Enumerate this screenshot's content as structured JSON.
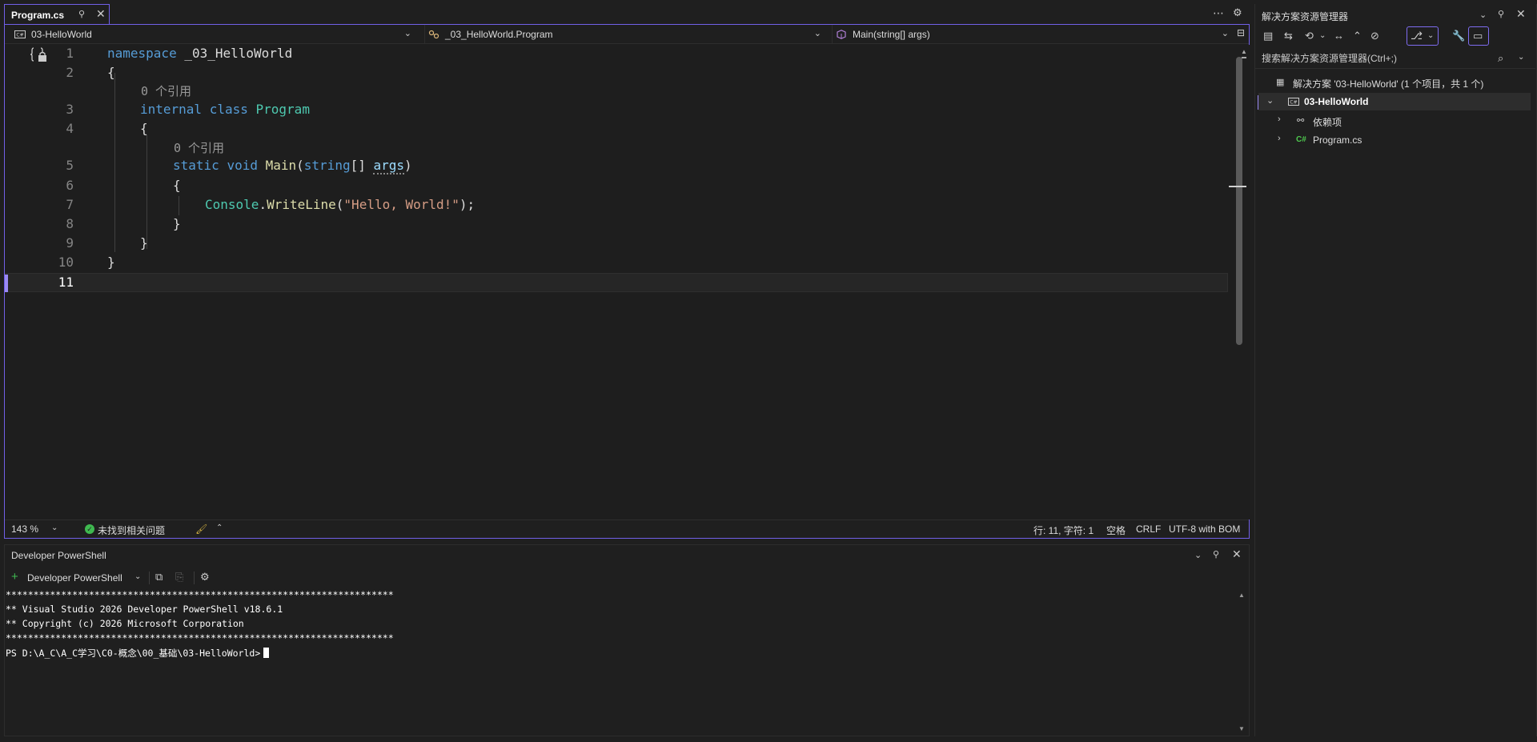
{
  "editor": {
    "tab": {
      "label": "Program.cs",
      "pin_icon": "pin-icon",
      "close_icon": "close-icon"
    },
    "nav": {
      "project": "03-HelloWorld",
      "class": "_03_HelloWorld.Program",
      "member": "Main(string[] args)"
    },
    "code": {
      "line_numbers": [
        "1",
        "2",
        "3",
        "4",
        "5",
        "6",
        "7",
        "8",
        "9",
        "10",
        "11"
      ],
      "codelens_refs": "0 个引用",
      "kw_namespace": "namespace",
      "ns_name": "_03_HelloWorld",
      "kw_internal": "internal",
      "kw_class": "class",
      "class_name": "Program",
      "kw_static": "static",
      "kw_void": "void",
      "method_name": "Main",
      "kw_string": "string",
      "param_name": "args",
      "console": "Console",
      "writeline": "WriteLine",
      "string_literal": "\"Hello, World!\"",
      "open_brace": "{",
      "close_brace": "}"
    },
    "status": {
      "zoom": "143 %",
      "issues": "未找到相关问题",
      "position": "行: 11, 字符: 1",
      "whitespace": "空格",
      "line_ending": "CRLF",
      "encoding": "UTF-8 with BOM"
    }
  },
  "terminal": {
    "title": "Developer PowerShell",
    "shell_label": "Developer PowerShell",
    "lines": [
      "**********************************************************************",
      "** Visual Studio 2026 Developer PowerShell v18.6.1",
      "** Copyright (c) 2026 Microsoft Corporation",
      "**********************************************************************"
    ],
    "prompt": "PS D:\\A_C\\A_C学习\\C0-概念\\00_基础\\03-HelloWorld>"
  },
  "solution_explorer": {
    "title": "解决方案资源管理器",
    "search_placeholder": "搜索解决方案资源管理器(Ctrl+;)",
    "tree": {
      "solution": "解决方案 '03-HelloWorld' (1 个项目，共 1 个)",
      "project": "03-HelloWorld",
      "dependencies": "依赖项",
      "file_icon_label": "C#",
      "file": "Program.cs"
    }
  },
  "colors": {
    "accent": "#7160e8",
    "keyword": "#569cd6",
    "type": "#4ec9b0",
    "method": "#dcdcaa",
    "string": "#d69d85",
    "parameter": "#9cdcfe",
    "success": "#3fb950"
  }
}
